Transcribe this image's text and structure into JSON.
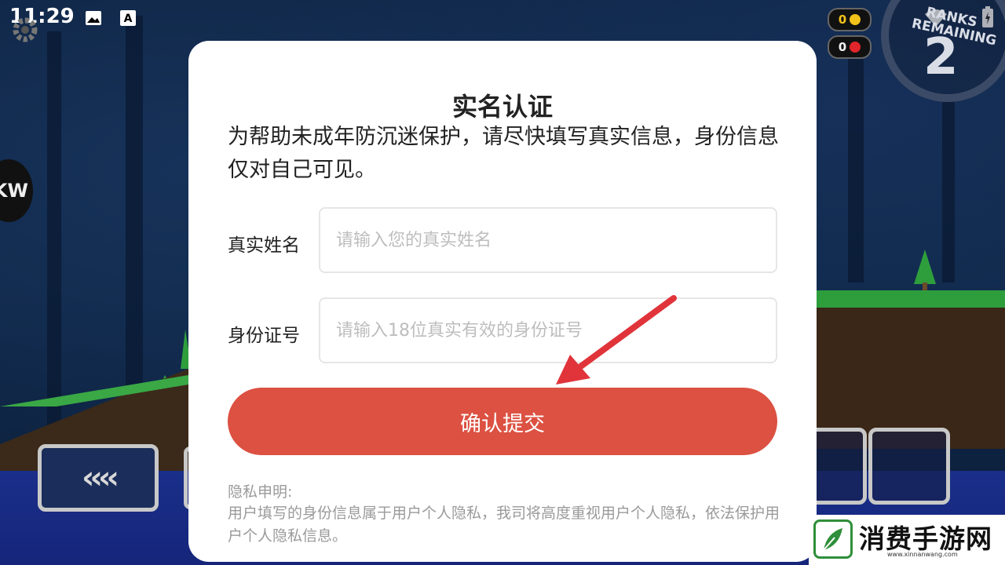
{
  "status_bar": {
    "time": "11:29",
    "icons": [
      "image-icon",
      "text-a-icon",
      "wifi-icon",
      "battery-icon"
    ]
  },
  "game": {
    "side_badge": "KW",
    "coins": [
      {
        "value": "0",
        "color": "#f3c21a"
      },
      {
        "value": "0",
        "color": "#e0262b"
      }
    ],
    "ranks_label": "RANKS REMAINING",
    "ranks_value": "2",
    "back_button": "‹‹‹‹"
  },
  "modal": {
    "title": "实名认证",
    "description": "为帮助未成年防沉迷保护，请尽快填写真实信息，身份信息仅对自己可见。",
    "name_field": {
      "label": "真实姓名",
      "placeholder": "请输入您的真实姓名",
      "value": ""
    },
    "id_field": {
      "label": "身份证号",
      "placeholder": "请输入18位真实有效的身份证号",
      "value": ""
    },
    "submit_label": "确认提交",
    "privacy_title": "隐私申明:",
    "privacy_text": "用户填写的身份信息属于用户个人隐私，我司将高度重视用户个人隐私，依法保护用户个人隐私信息。"
  },
  "annotation": {
    "arrow_color": "#e0343a"
  },
  "watermark": {
    "name": "消费手游网",
    "url": "www.xinnanwang.com"
  },
  "colors": {
    "accent": "#dc5142",
    "placeholder": "#bdbdbd",
    "muted_text": "#9a9a9a"
  }
}
